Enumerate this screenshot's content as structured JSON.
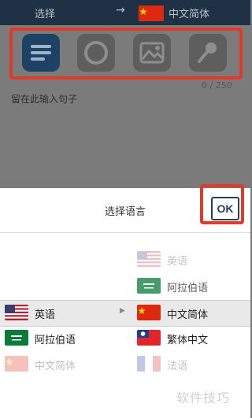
{
  "topbar": {
    "source_label": "选择",
    "arrow": "→",
    "target_label": "中文简体",
    "target_flag": "china-flag"
  },
  "input_modes": [
    {
      "name": "text-mode-icon",
      "active": true
    },
    {
      "name": "camera-mode-icon",
      "active": false
    },
    {
      "name": "image-mode-icon",
      "active": false
    },
    {
      "name": "microphone-mode-icon",
      "active": false
    }
  ],
  "editor": {
    "counter": "0 / 250",
    "placeholder": "留在此输入句子"
  },
  "sheet": {
    "title": "选择语言",
    "ok_label": "OK"
  },
  "left_column": [
    {
      "label": "英语",
      "flag": "usa-flag",
      "state": "selected"
    },
    {
      "label": "阿拉伯语",
      "flag": "saudi-flag",
      "state": "normal"
    },
    {
      "label": "中文简体",
      "flag": "china-flag",
      "state": "faded"
    }
  ],
  "right_column": [
    {
      "label": "英语",
      "flag": "usa-flag",
      "state": "faded"
    },
    {
      "label": "阿拉伯语",
      "flag": "saudi-flag",
      "state": "semi"
    },
    {
      "label": "中文简体",
      "flag": "china-flag",
      "state": "selected"
    },
    {
      "label": "繁体中文",
      "flag": "taiwan-flag",
      "state": "normal"
    },
    {
      "label": "法语",
      "flag": "france-flag",
      "state": "faded"
    }
  ],
  "watermark": "软件技巧",
  "colors": {
    "topbar": "#1f3145",
    "accent": "#1e4266",
    "highlight": "#e23a2a"
  }
}
